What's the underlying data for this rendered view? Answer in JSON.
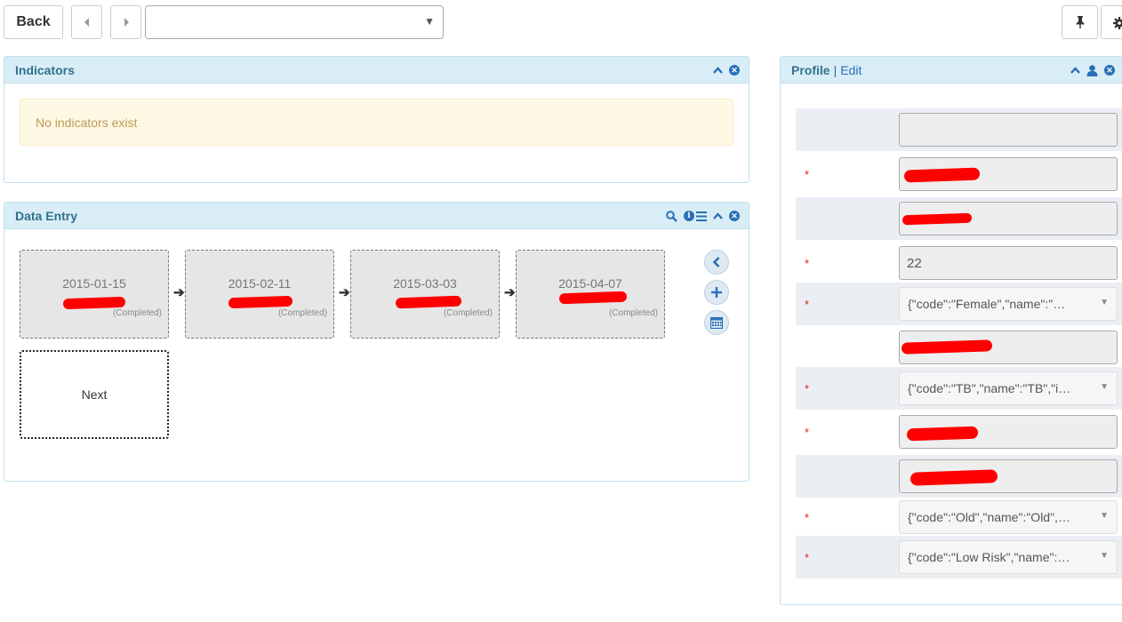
{
  "toolbar": {
    "back_label": "Back",
    "prev_icon": "caret-left-icon",
    "next_icon": "caret-right-icon",
    "selector_value": "",
    "pin_icon": "thumbtack-icon",
    "settings_icon": "gear-icon"
  },
  "indicators": {
    "title": "Indicators",
    "empty_message": "No indicators exist"
  },
  "data_entry": {
    "title": "Data Entry",
    "events": [
      {
        "date": "2015-01-15",
        "status": "(Completed)"
      },
      {
        "date": "2015-02-11",
        "status": "(Completed)"
      },
      {
        "date": "2015-03-03",
        "status": "(Completed)"
      },
      {
        "date": "2015-04-07",
        "status": "(Completed)"
      }
    ],
    "next_label": "Next"
  },
  "profile": {
    "title": "Profile",
    "separator": "|",
    "edit_label": "Edit",
    "fields": [
      {
        "required": false,
        "kind": "input",
        "value": ""
      },
      {
        "required": true,
        "kind": "input",
        "value": ""
      },
      {
        "required": false,
        "kind": "input",
        "value": ""
      },
      {
        "required": true,
        "kind": "input",
        "value": "22"
      },
      {
        "required": true,
        "kind": "select",
        "value": "{\"code\":\"Female\",\"name\":\"…"
      },
      {
        "required": false,
        "kind": "input",
        "value": ""
      },
      {
        "required": true,
        "kind": "select",
        "value": "{\"code\":\"TB\",\"name\":\"TB\",\"i…"
      },
      {
        "required": true,
        "kind": "input",
        "value": ""
      },
      {
        "required": false,
        "kind": "input",
        "value": ""
      },
      {
        "required": true,
        "kind": "select",
        "value": "{\"code\":\"Old\",\"name\":\"Old\",…"
      },
      {
        "required": true,
        "kind": "select",
        "value": "{\"code\":\"Low Risk\",\"name\":…"
      }
    ],
    "required_marker": "*"
  },
  "colors": {
    "panel_header_bg": "#d9edf7",
    "panel_title": "#31708f",
    "icon_blue": "#2a6fb8",
    "alert_bg": "#fcf8e3",
    "alert_text": "#c09853",
    "redaction": "#ff0000"
  }
}
